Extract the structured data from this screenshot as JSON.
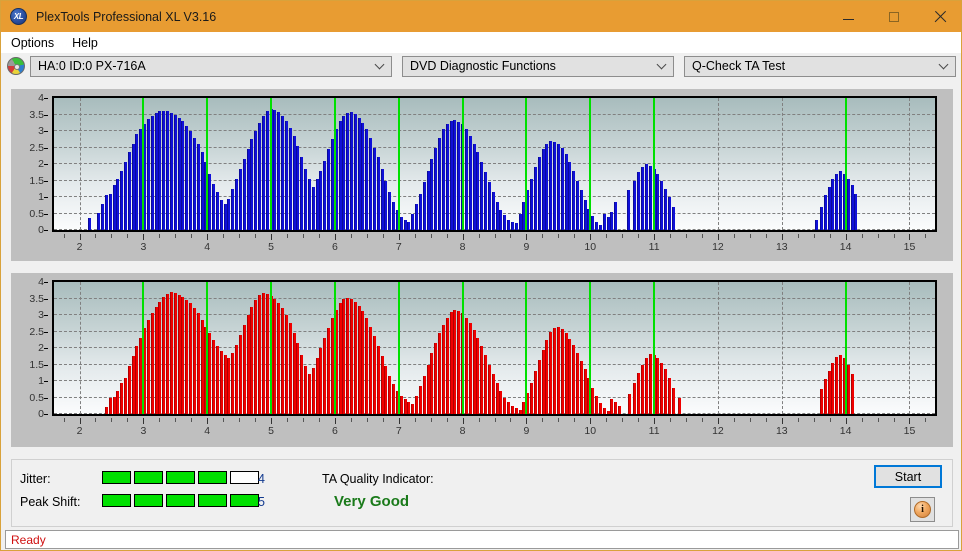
{
  "window": {
    "title": "PlexTools Professional XL V3.16",
    "icon": "XL",
    "app_icon_name": "plextools-logo",
    "controls": {
      "minimize": "minimize",
      "maximize": "maximize",
      "close": "close"
    },
    "accent": "#e89c32"
  },
  "menu": {
    "items": [
      {
        "label": "Options"
      },
      {
        "label": "Help"
      }
    ]
  },
  "toolbar": {
    "drive_icon": "disc-icon",
    "drive": {
      "value": "HA:0 ID:0  PX-716A"
    },
    "function": {
      "value": "DVD Diagnostic Functions"
    },
    "test": {
      "value": "Q-Check TA Test"
    }
  },
  "charts": {
    "y_ticks": [
      "4",
      "3.5",
      "3",
      "2.5",
      "2",
      "1.5",
      "1",
      "0.5",
      "0"
    ],
    "x_ticks": [
      "2",
      "3",
      "4",
      "5",
      "6",
      "7",
      "8",
      "9",
      "10",
      "11",
      "12",
      "13",
      "14",
      "15"
    ]
  },
  "chart_data": [
    {
      "type": "bar",
      "name": "jitter-trace",
      "title": "",
      "color": "#1010d8",
      "xlabel": "",
      "ylabel": "",
      "xlim": [
        1.6,
        15.4
      ],
      "ylim": [
        0,
        4
      ],
      "grid": true,
      "y_ticks": [
        0,
        0.5,
        1,
        1.5,
        2,
        2.5,
        3,
        3.5,
        4
      ],
      "x_ticks": [
        2,
        3,
        4,
        5,
        6,
        7,
        8,
        9,
        10,
        11,
        12,
        13,
        14,
        15
      ],
      "markers_x": [
        3,
        4,
        5,
        6,
        7,
        8,
        9,
        10,
        11,
        14
      ],
      "x": [
        2.15,
        2.3,
        2.36,
        2.42,
        2.48,
        2.54,
        2.6,
        2.66,
        2.72,
        2.78,
        2.84,
        2.9,
        2.96,
        3.02,
        3.08,
        3.14,
        3.2,
        3.26,
        3.32,
        3.38,
        3.44,
        3.5,
        3.56,
        3.62,
        3.68,
        3.74,
        3.8,
        3.86,
        3.92,
        3.98,
        4.04,
        4.1,
        4.16,
        4.22,
        4.28,
        4.34,
        4.4,
        4.46,
        4.52,
        4.58,
        4.64,
        4.7,
        4.76,
        4.82,
        4.88,
        4.94,
        5.0,
        5.06,
        5.12,
        5.18,
        5.24,
        5.3,
        5.36,
        5.42,
        5.48,
        5.54,
        5.6,
        5.66,
        5.72,
        5.78,
        5.84,
        5.9,
        5.96,
        6.02,
        6.08,
        6.14,
        6.2,
        6.26,
        6.32,
        6.38,
        6.44,
        6.5,
        6.56,
        6.62,
        6.68,
        6.74,
        6.8,
        6.86,
        6.92,
        6.98,
        7.04,
        7.1,
        7.16,
        7.22,
        7.28,
        7.34,
        7.4,
        7.46,
        7.52,
        7.58,
        7.64,
        7.7,
        7.76,
        7.82,
        7.88,
        7.94,
        8.0,
        8.06,
        8.12,
        8.18,
        8.24,
        8.3,
        8.36,
        8.42,
        8.48,
        8.54,
        8.6,
        8.66,
        8.72,
        8.78,
        8.84,
        8.9,
        8.96,
        9.02,
        9.08,
        9.14,
        9.2,
        9.26,
        9.32,
        9.38,
        9.44,
        9.5,
        9.56,
        9.62,
        9.68,
        9.74,
        9.8,
        9.86,
        9.92,
        9.98,
        10.04,
        10.1,
        10.16,
        10.22,
        10.28,
        10.34,
        10.4,
        10.6,
        10.7,
        10.76,
        10.82,
        10.88,
        10.94,
        11.0,
        11.06,
        11.12,
        11.18,
        11.24,
        11.3,
        13.55,
        13.62,
        13.68,
        13.74,
        13.8,
        13.86,
        13.92,
        13.98,
        14.04,
        14.1,
        14.16
      ],
      "values": [
        0.35,
        0.52,
        0.8,
        1.05,
        1.1,
        1.35,
        1.55,
        1.8,
        2.05,
        2.35,
        2.6,
        2.9,
        3.05,
        3.2,
        3.35,
        3.45,
        3.55,
        3.6,
        3.62,
        3.6,
        3.55,
        3.5,
        3.4,
        3.3,
        3.15,
        3.0,
        2.8,
        2.6,
        2.35,
        2.05,
        1.7,
        1.4,
        1.15,
        0.9,
        0.8,
        0.95,
        1.25,
        1.55,
        1.85,
        2.15,
        2.45,
        2.75,
        3.0,
        3.25,
        3.45,
        3.6,
        3.68,
        3.65,
        3.58,
        3.45,
        3.3,
        3.1,
        2.85,
        2.55,
        2.2,
        1.85,
        1.55,
        1.3,
        1.55,
        1.8,
        2.1,
        2.45,
        2.75,
        3.05,
        3.3,
        3.45,
        3.55,
        3.58,
        3.52,
        3.4,
        3.25,
        3.05,
        2.8,
        2.5,
        2.2,
        1.85,
        1.5,
        1.15,
        0.85,
        0.6,
        0.4,
        0.3,
        0.25,
        0.5,
        0.8,
        1.1,
        1.45,
        1.8,
        2.15,
        2.5,
        2.8,
        3.05,
        3.2,
        3.3,
        3.32,
        3.28,
        3.2,
        3.05,
        2.85,
        2.6,
        2.35,
        2.05,
        1.75,
        1.45,
        1.15,
        0.85,
        0.6,
        0.45,
        0.3,
        0.25,
        0.2,
        0.5,
        0.85,
        1.2,
        1.55,
        1.9,
        2.2,
        2.45,
        2.62,
        2.7,
        2.68,
        2.6,
        2.48,
        2.3,
        2.05,
        1.8,
        1.5,
        1.2,
        0.9,
        0.65,
        0.42,
        0.25,
        0.15,
        0.5,
        0.4,
        0.55,
        0.85,
        1.2,
        1.5,
        1.75,
        1.9,
        2.0,
        1.95,
        1.85,
        1.7,
        1.5,
        1.25,
        1.0,
        0.7,
        0.3,
        0.7,
        1.05,
        1.3,
        1.55,
        1.7,
        1.78,
        1.7,
        1.55,
        1.35,
        1.1
      ]
    },
    {
      "type": "bar",
      "name": "peak-shift-trace",
      "title": "",
      "color": "#f00000",
      "xlabel": "",
      "ylabel": "",
      "xlim": [
        1.6,
        15.4
      ],
      "ylim": [
        0,
        4
      ],
      "grid": true,
      "y_ticks": [
        0,
        0.5,
        1,
        1.5,
        2,
        2.5,
        3,
        3.5,
        4
      ],
      "x_ticks": [
        2,
        3,
        4,
        5,
        6,
        7,
        8,
        9,
        10,
        11,
        12,
        13,
        14,
        15
      ],
      "markers_x": [
        3,
        4,
        5,
        6,
        7,
        8,
        9,
        10,
        11,
        14
      ],
      "x": [
        2.42,
        2.48,
        2.54,
        2.6,
        2.66,
        2.72,
        2.78,
        2.84,
        2.9,
        2.96,
        3.02,
        3.08,
        3.14,
        3.2,
        3.26,
        3.32,
        3.38,
        3.44,
        3.5,
        3.56,
        3.62,
        3.68,
        3.74,
        3.8,
        3.86,
        3.92,
        3.98,
        4.04,
        4.1,
        4.16,
        4.22,
        4.28,
        4.34,
        4.4,
        4.46,
        4.52,
        4.58,
        4.64,
        4.7,
        4.76,
        4.82,
        4.88,
        4.94,
        5.0,
        5.06,
        5.12,
        5.18,
        5.24,
        5.3,
        5.36,
        5.42,
        5.48,
        5.54,
        5.6,
        5.66,
        5.72,
        5.78,
        5.84,
        5.9,
        5.96,
        6.02,
        6.08,
        6.14,
        6.2,
        6.26,
        6.32,
        6.38,
        6.44,
        6.5,
        6.56,
        6.62,
        6.68,
        6.74,
        6.8,
        6.86,
        6.92,
        6.98,
        7.04,
        7.1,
        7.16,
        7.22,
        7.28,
        7.34,
        7.4,
        7.46,
        7.52,
        7.58,
        7.64,
        7.7,
        7.76,
        7.82,
        7.88,
        7.94,
        8.0,
        8.06,
        8.12,
        8.18,
        8.24,
        8.3,
        8.36,
        8.42,
        8.48,
        8.54,
        8.6,
        8.66,
        8.72,
        8.78,
        8.84,
        8.9,
        8.96,
        9.02,
        9.08,
        9.14,
        9.2,
        9.26,
        9.32,
        9.38,
        9.44,
        9.5,
        9.56,
        9.62,
        9.68,
        9.74,
        9.8,
        9.86,
        9.92,
        9.98,
        10.04,
        10.1,
        10.16,
        10.22,
        10.28,
        10.34,
        10.4,
        10.46,
        10.62,
        10.7,
        10.76,
        10.82,
        10.88,
        10.94,
        11.0,
        11.06,
        11.12,
        11.18,
        11.24,
        11.3,
        11.4,
        13.62,
        13.68,
        13.74,
        13.8,
        13.86,
        13.92,
        13.98,
        14.04,
        14.1
      ],
      "values": [
        0.2,
        0.5,
        0.52,
        0.7,
        0.95,
        1.1,
        1.45,
        1.75,
        2.05,
        2.3,
        2.6,
        2.85,
        3.05,
        3.25,
        3.4,
        3.55,
        3.65,
        3.7,
        3.68,
        3.62,
        3.55,
        3.45,
        3.35,
        3.2,
        3.05,
        2.85,
        2.65,
        2.45,
        2.25,
        2.05,
        1.9,
        1.8,
        1.7,
        1.85,
        2.1,
        2.4,
        2.7,
        3.0,
        3.25,
        3.45,
        3.6,
        3.68,
        3.65,
        3.58,
        3.48,
        3.35,
        3.2,
        3.0,
        2.75,
        2.45,
        2.15,
        1.8,
        1.45,
        1.2,
        1.4,
        1.7,
        2.0,
        2.3,
        2.6,
        2.9,
        3.15,
        3.35,
        3.48,
        3.52,
        3.48,
        3.4,
        3.28,
        3.12,
        2.9,
        2.65,
        2.35,
        2.05,
        1.75,
        1.45,
        1.15,
        0.9,
        0.7,
        0.55,
        0.45,
        0.35,
        0.3,
        0.55,
        0.85,
        1.15,
        1.5,
        1.85,
        2.15,
        2.45,
        2.7,
        2.92,
        3.08,
        3.15,
        3.12,
        3.05,
        2.92,
        2.75,
        2.55,
        2.3,
        2.05,
        1.8,
        1.5,
        1.2,
        0.95,
        0.7,
        0.5,
        0.35,
        0.25,
        0.18,
        0.12,
        0.35,
        0.65,
        0.95,
        1.3,
        1.65,
        1.95,
        2.25,
        2.48,
        2.62,
        2.65,
        2.58,
        2.45,
        2.28,
        2.08,
        1.85,
        1.6,
        1.35,
        1.08,
        0.8,
        0.55,
        0.32,
        0.18,
        0.1,
        0.45,
        0.35,
        0.25,
        0.6,
        0.95,
        1.25,
        1.5,
        1.7,
        1.82,
        1.78,
        1.7,
        1.55,
        1.35,
        1.1,
        0.8,
        0.5,
        0.75,
        1.05,
        1.3,
        1.55,
        1.72,
        1.8,
        1.7,
        1.5,
        1.2
      ]
    }
  ],
  "bottom": {
    "jitter": {
      "label": "Jitter:",
      "value": "4",
      "filled": 4,
      "total": 5
    },
    "peak_shift": {
      "label": "Peak Shift:",
      "value": "5",
      "filled": 5,
      "total": 5
    },
    "quality": {
      "label": "TA Quality Indicator:",
      "value": "Very Good",
      "color": "#1a7a1a"
    },
    "start_label": "Start",
    "info_icon": "info-icon",
    "info_glyph": "i"
  },
  "status": {
    "text": "Ready",
    "color": "#d01010"
  }
}
